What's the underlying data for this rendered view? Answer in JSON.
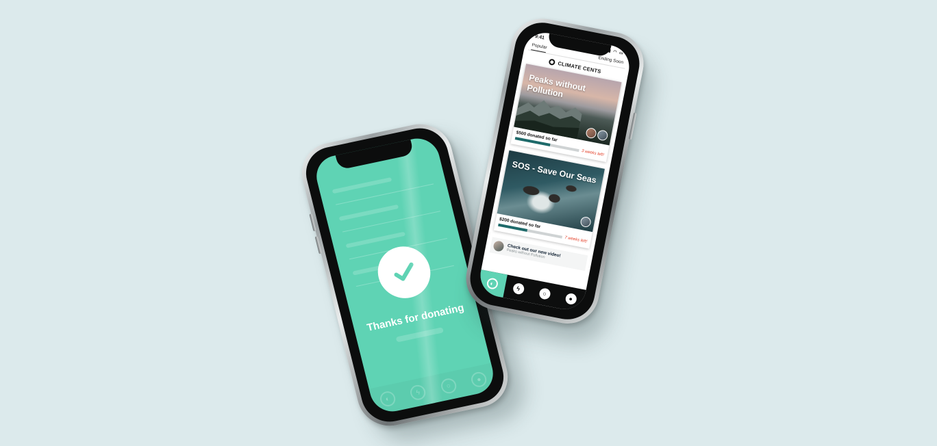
{
  "colors": {
    "background": "#dceaec",
    "accent_mint": "#5fd3b4",
    "progress_fill": "#1e6a6a",
    "deadline_red": "#e4422b",
    "nav_dark": "#0d0e0e"
  },
  "left_phone": {
    "message": "Thanks for donating",
    "icon": "checkmark-icon",
    "nav_icons": [
      "leaf-icon",
      "bolt-icon",
      "search-icon",
      "profile-icon"
    ]
  },
  "right_phone": {
    "status_bar": {
      "time": "9:41"
    },
    "tabs": [
      {
        "label": "Popular",
        "active": true
      },
      {
        "label": "Ending Soon",
        "active": false
      }
    ],
    "brand": "CLIMATE CENTS",
    "campaigns": [
      {
        "title": "Peaks without Pollution",
        "donated": "$500 donated so far",
        "progress": 0.55,
        "deadline": "3 weeks left!"
      },
      {
        "title": "SOS - Save Our Seas",
        "donated": "$200 donated so far",
        "progress": 0.45,
        "deadline": "7 weeks left!"
      }
    ],
    "promo": {
      "title": "Check out our new video!",
      "subtitle": "Peaks without Pollution"
    },
    "nav_icons": [
      "leaf-icon",
      "bolt-icon",
      "search-icon",
      "profile-icon"
    ]
  }
}
